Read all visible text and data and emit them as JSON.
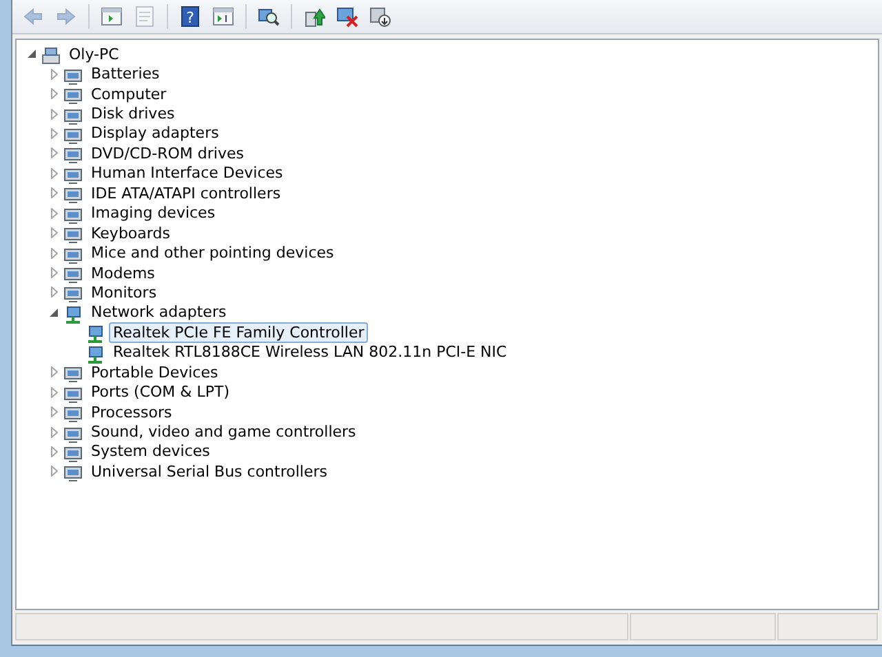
{
  "toolbar": [
    {
      "kind": "back",
      "disabled": true
    },
    {
      "kind": "forward",
      "disabled": true
    },
    {
      "kind": "sep"
    },
    {
      "kind": "console",
      "disabled": false
    },
    {
      "kind": "properties",
      "disabled": true
    },
    {
      "kind": "sep"
    },
    {
      "kind": "help",
      "disabled": false,
      "glyph": "?"
    },
    {
      "kind": "action",
      "disabled": false
    },
    {
      "kind": "sep"
    },
    {
      "kind": "scan",
      "disabled": false
    },
    {
      "kind": "sep"
    },
    {
      "kind": "update",
      "disabled": false
    },
    {
      "kind": "disable",
      "disabled": false
    },
    {
      "kind": "uninstall",
      "disabled": false
    }
  ],
  "tree": {
    "label": "Oly-PC",
    "expanded": true,
    "children": [
      {
        "label": "Batteries",
        "expanded": false
      },
      {
        "label": "Computer",
        "expanded": false
      },
      {
        "label": "Disk drives",
        "expanded": false
      },
      {
        "label": "Display adapters",
        "expanded": false
      },
      {
        "label": "DVD/CD-ROM drives",
        "expanded": false
      },
      {
        "label": "Human Interface Devices",
        "expanded": false
      },
      {
        "label": "IDE ATA/ATAPI controllers",
        "expanded": false
      },
      {
        "label": "Imaging devices",
        "expanded": false
      },
      {
        "label": "Keyboards",
        "expanded": false
      },
      {
        "label": "Mice and other pointing devices",
        "expanded": false
      },
      {
        "label": "Modems",
        "expanded": false
      },
      {
        "label": "Monitors",
        "expanded": false
      },
      {
        "label": "Network adapters",
        "expanded": true,
        "children": [
          {
            "label": "Realtek PCIe FE Family Controller",
            "selected": true
          },
          {
            "label": "Realtek RTL8188CE Wireless LAN 802.11n PCI-E NIC",
            "selected": false
          }
        ]
      },
      {
        "label": "Portable Devices",
        "expanded": false
      },
      {
        "label": "Ports (COM & LPT)",
        "expanded": false
      },
      {
        "label": "Processors",
        "expanded": false
      },
      {
        "label": "Sound, video and game controllers",
        "expanded": false
      },
      {
        "label": "System devices",
        "expanded": false
      },
      {
        "label": "Universal Serial Bus controllers",
        "expanded": false
      }
    ]
  }
}
